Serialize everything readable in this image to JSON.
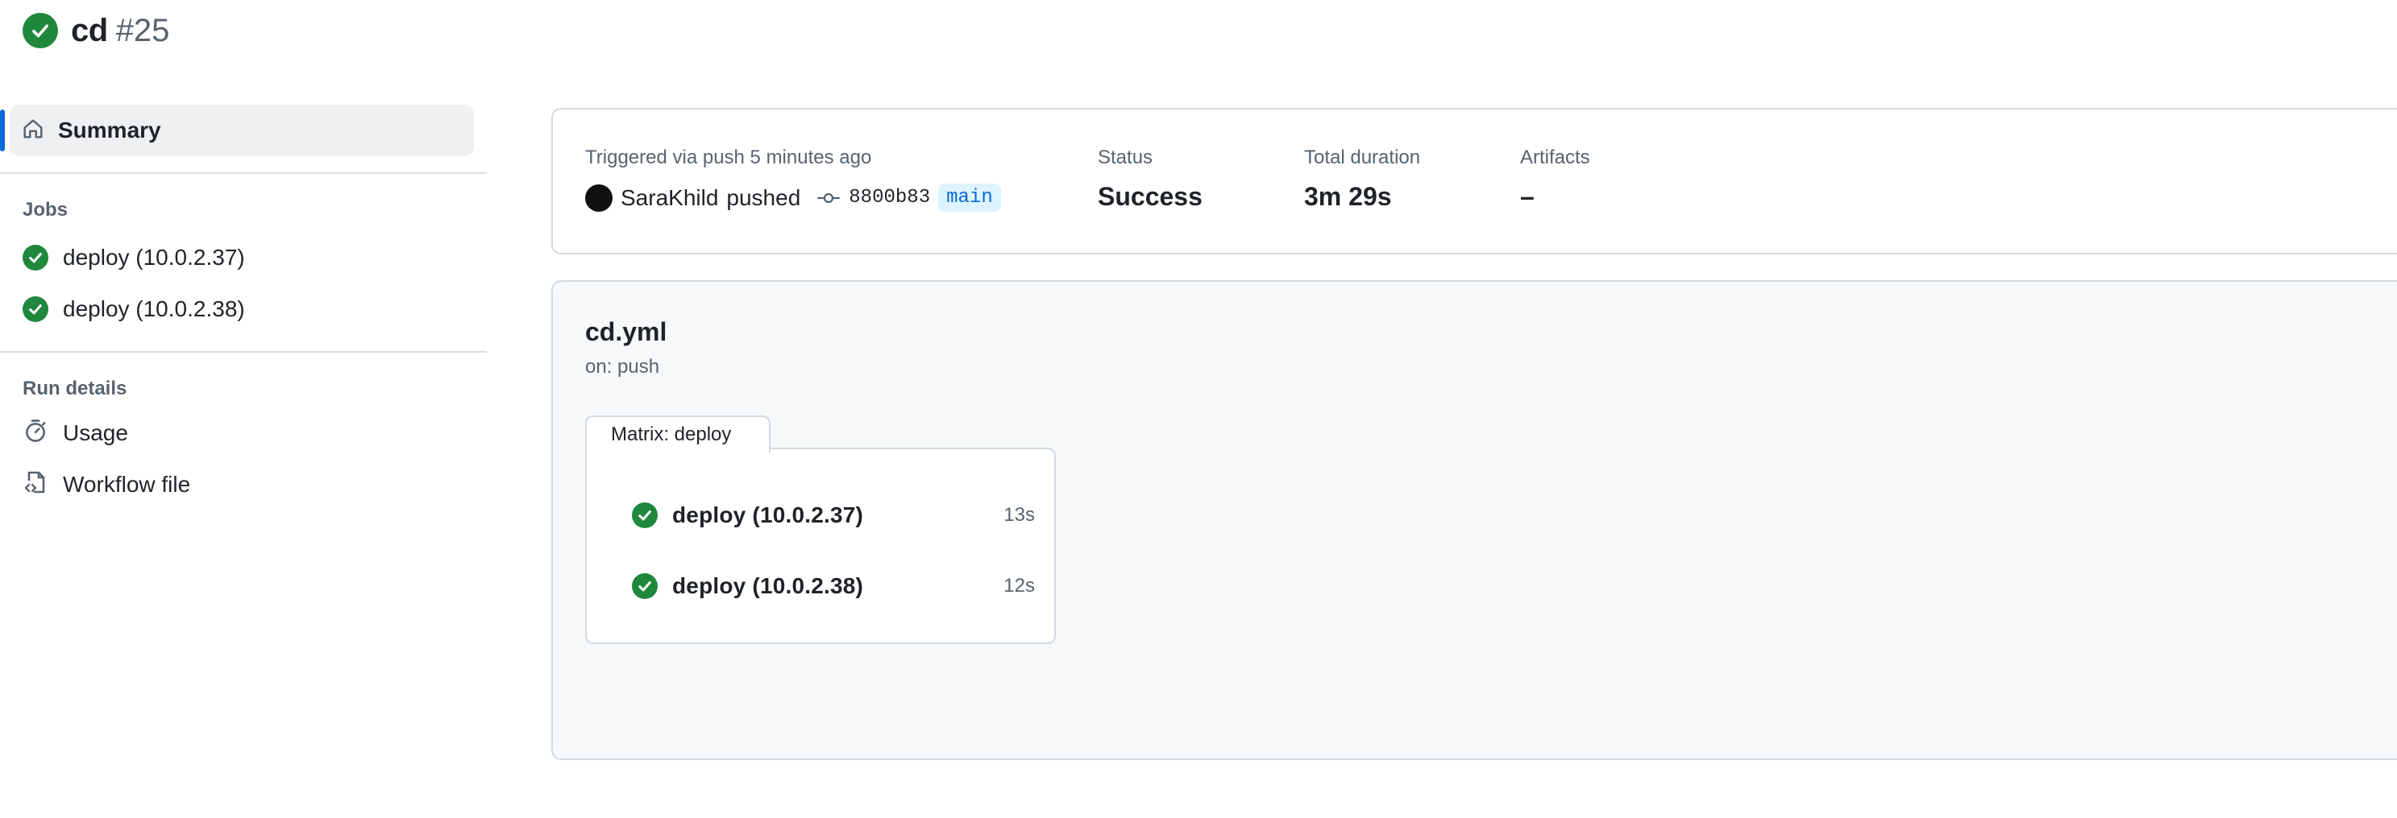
{
  "header": {
    "workflow_name": "cd",
    "run_number": "#25",
    "status_icon": "check-circle-fill-icon"
  },
  "sidebar": {
    "summary_label": "Summary",
    "jobs_heading": "Jobs",
    "jobs": [
      {
        "label": "deploy (10.0.2.37)",
        "status": "success"
      },
      {
        "label": "deploy (10.0.2.38)",
        "status": "success"
      }
    ],
    "run_details_heading": "Run details",
    "run_details": [
      {
        "label": "Usage",
        "icon": "stopwatch-icon"
      },
      {
        "label": "Workflow file",
        "icon": "file-code-icon"
      }
    ]
  },
  "summary": {
    "trigger_text": "Triggered via push 5 minutes ago",
    "actor": "SaraKhild",
    "action": "pushed",
    "commit_sha": "8800b83",
    "branch": "main",
    "status_label": "Status",
    "status_value": "Success",
    "duration_label": "Total duration",
    "duration_value": "3m 29s",
    "artifacts_label": "Artifacts",
    "artifacts_value": "–"
  },
  "graph": {
    "workflow_file": "cd.yml",
    "trigger": "on: push",
    "matrix_label": "Matrix: deploy",
    "jobs": [
      {
        "name": "deploy (10.0.2.37)",
        "duration": "13s"
      },
      {
        "name": "deploy (10.0.2.38)",
        "duration": "12s"
      }
    ]
  },
  "colors": {
    "success": "#1f883d",
    "accent": "#0969da",
    "muted_text": "#59636e",
    "border": "#d1d9e0"
  }
}
